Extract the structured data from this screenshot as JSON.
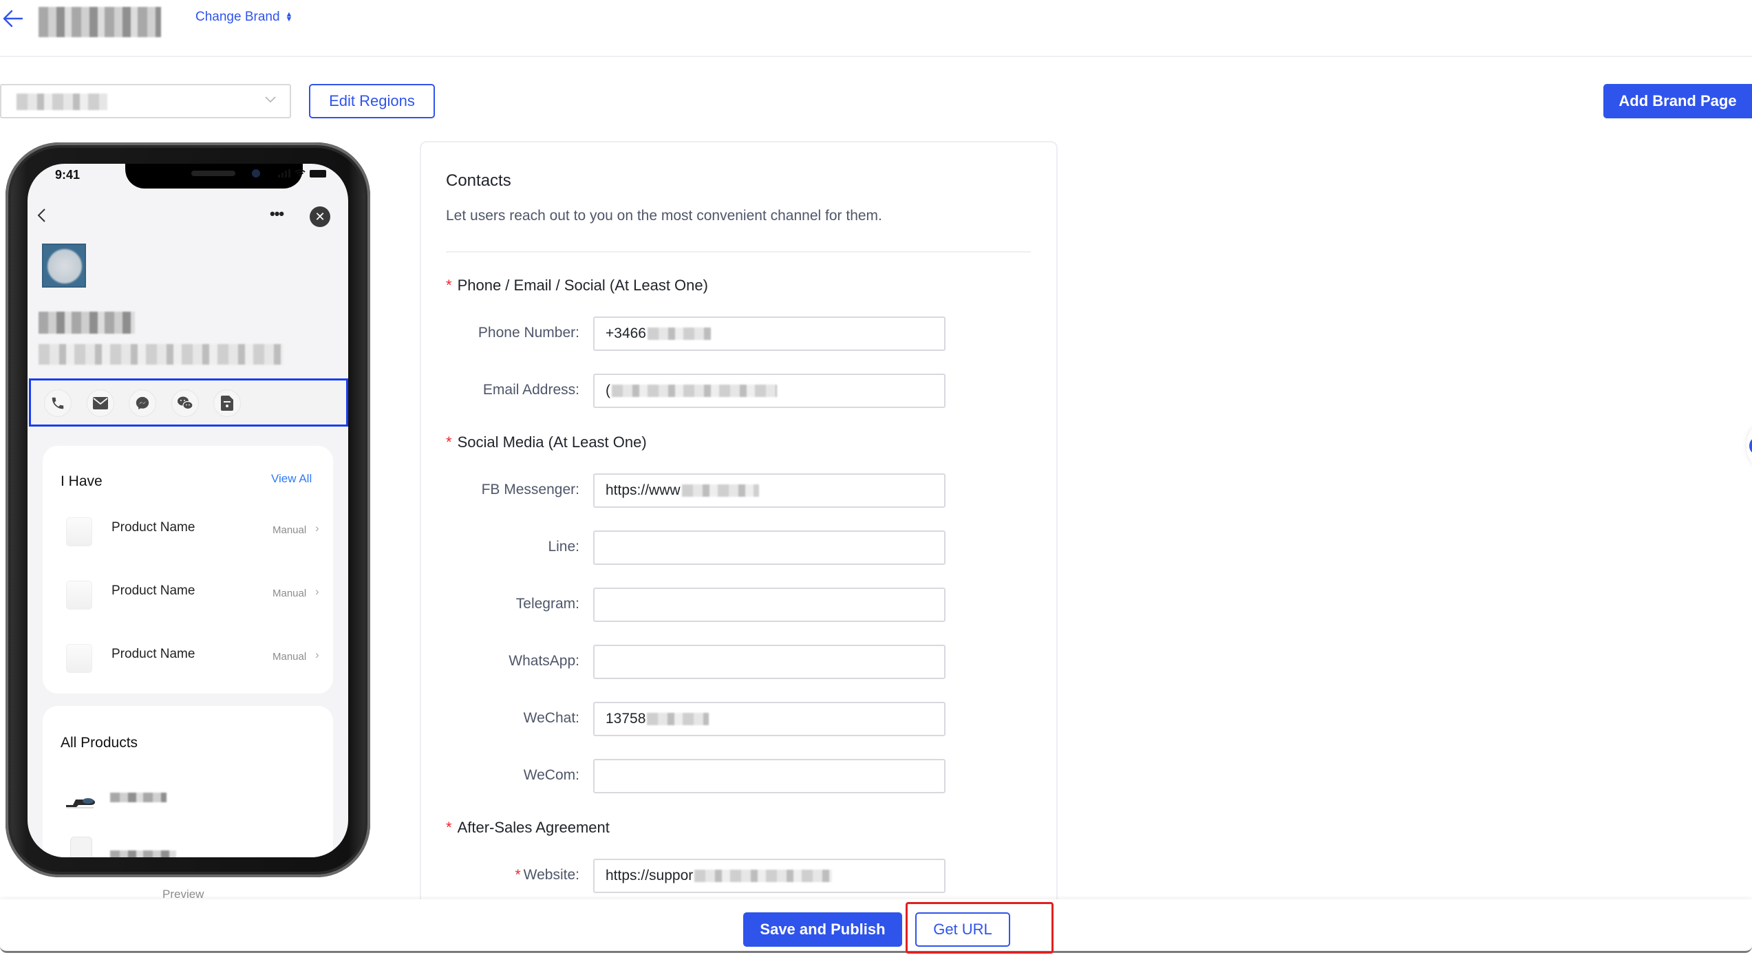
{
  "header": {
    "back_icon": "arrow-left-icon",
    "brand_name_masked": true,
    "change_brand_label": "Change Brand",
    "change_brand_icon": "sort-caret-icon"
  },
  "toolbar": {
    "region_select_value_masked": true,
    "edit_regions_label": "Edit Regions",
    "add_brand_page_label": "Add Brand Page"
  },
  "colors": {
    "primary": "#2f54eb",
    "required": "#f5222d",
    "highlight": "#e02020"
  },
  "preview": {
    "status_time": "9:41",
    "more_label": "•••",
    "close_label": "✕",
    "contact_icons": [
      "phone-icon",
      "email-icon",
      "messenger-icon",
      "wechat-icon",
      "wecom-icon"
    ],
    "i_have": {
      "title": "I Have",
      "view_all": "View All",
      "items": [
        {
          "name": "Product Name",
          "action": "Manual",
          "chevron": "›"
        },
        {
          "name": "Product Name",
          "action": "Manual",
          "chevron": "›"
        },
        {
          "name": "Product Name",
          "action": "Manual",
          "chevron": "›"
        }
      ]
    },
    "all_products": {
      "title": "All Products"
    },
    "label": "Preview"
  },
  "form": {
    "title": "Contacts",
    "description": "Let users reach out to you on the most convenient channel for them.",
    "sections": [
      {
        "title": "Phone / Email / Social (At Least One)",
        "required": true,
        "fields": [
          {
            "label": "Phone Number",
            "value": "+3466",
            "masked": true,
            "required": false
          },
          {
            "label": "Email Address",
            "value": "(",
            "masked": true,
            "required": false
          }
        ]
      },
      {
        "title": "Social Media (At Least One)",
        "required": true,
        "fields": [
          {
            "label": "FB Messenger",
            "value": "https://www",
            "masked": true,
            "required": false
          },
          {
            "label": "Line",
            "value": "",
            "masked": false,
            "required": false
          },
          {
            "label": "Telegram",
            "value": "",
            "masked": false,
            "required": false
          },
          {
            "label": "WhatsApp",
            "value": "",
            "masked": false,
            "required": false
          },
          {
            "label": "WeChat",
            "value": "13758",
            "masked": true,
            "required": false
          },
          {
            "label": "WeCom",
            "value": "",
            "masked": false,
            "required": false
          }
        ]
      },
      {
        "title": "After-Sales Agreement",
        "required": true,
        "fields": [
          {
            "label": "Website",
            "value": "https://suppor",
            "masked": true,
            "required": true
          }
        ]
      }
    ],
    "label_suffix": ":",
    "required_mark": "*"
  },
  "footer": {
    "save_publish_label": "Save and Publish",
    "get_url_label": "Get URL"
  }
}
